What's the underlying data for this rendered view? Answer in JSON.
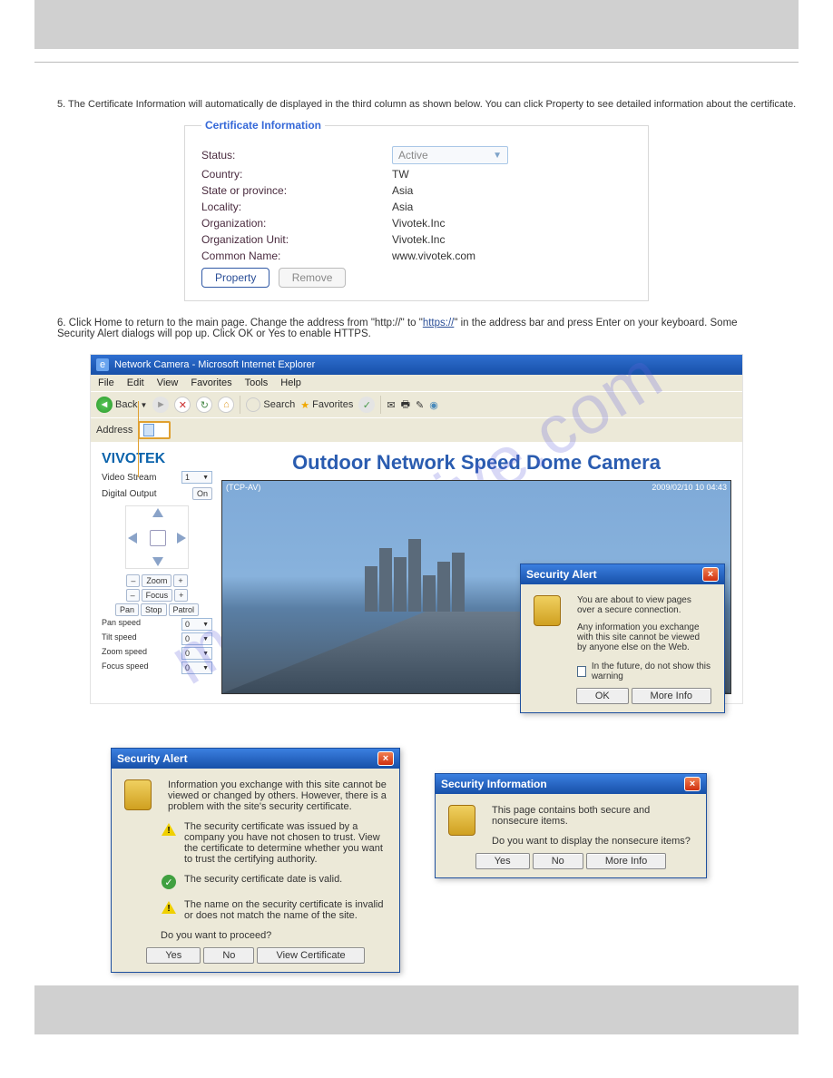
{
  "header": {
    "blank": ""
  },
  "step5": "5. The Certificate Information will automatically de displayed in the third column as shown below. You can click Property to see detailed information about the certificate.",
  "certificate": {
    "legend": "Certificate Information",
    "rows": [
      {
        "label": "Status:",
        "value": "Active",
        "type": "select"
      },
      {
        "label": "Country:",
        "value": "TW",
        "type": "text"
      },
      {
        "label": "State or province:",
        "value": "Asia",
        "type": "text"
      },
      {
        "label": "Locality:",
        "value": "Asia",
        "type": "text"
      },
      {
        "label": "Organization:",
        "value": "Vivotek.Inc",
        "type": "text"
      },
      {
        "label": "Organization Unit:",
        "value": "Vivotek.Inc",
        "type": "text"
      },
      {
        "label": "Common Name:",
        "value": "www.vivotek.com",
        "type": "text"
      }
    ],
    "buttons": {
      "property": "Property",
      "remove": "Remove"
    }
  },
  "step6_pre": "6. Click Home to return to the main page. Change the address from \"http://\" to \"",
  "step6_link": "https://",
  "step6_post": "\" in the address bar and press Enter on your keyboard. Some Security Alert dialogs will pop up. Click OK or Yes to enable HTTPS.",
  "watermark": "manualshive.com",
  "browser": {
    "title": "Network Camera - Microsoft Internet Explorer",
    "menus": [
      "File",
      "Edit",
      "View",
      "Favorites",
      "Tools",
      "Help"
    ],
    "toolbar": {
      "back": "Back",
      "search": "Search",
      "favorites": "Favorites"
    },
    "address_label": "Address"
  },
  "camera": {
    "brand": "VIVOTEK",
    "title": "Outdoor Network Speed Dome Camera",
    "video_stream_lbl": "Video Stream",
    "video_stream_val": "1",
    "digital_out_lbl": "Digital Output",
    "zoom": "Zoom",
    "focus": "Focus",
    "pan_stop_patrol": [
      "Pan",
      "Stop",
      "Patrol"
    ],
    "speeds": [
      {
        "label": "Pan speed",
        "val": "0"
      },
      {
        "label": "Tilt speed",
        "val": "0"
      },
      {
        "label": "Zoom speed",
        "val": "0"
      },
      {
        "label": "Focus speed",
        "val": "0"
      }
    ],
    "overlay_tl": "(TCP-AV)",
    "overlay_tr": "2009/02/10 10 04:43"
  },
  "dialog1": {
    "title": "Security Alert",
    "line1": "You are about to view pages over a secure connection.",
    "line2": "Any information you exchange with this site cannot be viewed by anyone else on the Web.",
    "checkbox": "In the future, do not show this warning",
    "ok": "OK",
    "more": "More Info"
  },
  "dialog2": {
    "title": "Security Alert",
    "intro": "Information you exchange with this site cannot be viewed or changed by others. However, there is a problem with the site's security certificate.",
    "items": [
      {
        "icon": "warn",
        "text": "The security certificate was issued by a company you have not chosen to trust. View the certificate to determine whether you want to trust the certifying authority."
      },
      {
        "icon": "ok",
        "text": "The security certificate date is valid."
      },
      {
        "icon": "warn",
        "text": "The name on the security certificate is invalid or does not match the name of the site."
      }
    ],
    "question": "Do you want to proceed?",
    "yes": "Yes",
    "no": "No",
    "view": "View Certificate"
  },
  "dialog3": {
    "title": "Security Information",
    "line1": "This page contains both secure and nonsecure items.",
    "line2": "Do you want to display the nonsecure items?",
    "yes": "Yes",
    "no": "No",
    "more": "More Info"
  }
}
